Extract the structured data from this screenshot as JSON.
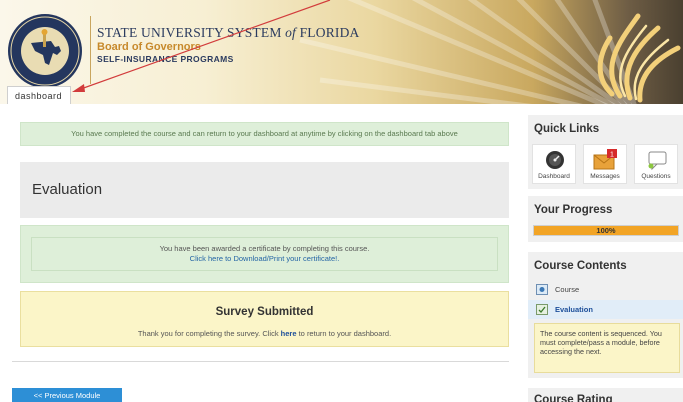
{
  "header": {
    "org_line1_part1": "STATE UNIVERSITY SYSTEM ",
    "org_line1_of": "of",
    "org_line1_part2": " FLORIDA",
    "org_line2": "Board of Governors",
    "org_line3": "SELF-INSURANCE PROGRAMS",
    "dashboard_tab": "dashboard",
    "colors": {
      "navy": "#2b3b5f",
      "gold": "#c7892b"
    }
  },
  "main": {
    "completed_notice": "You have completed the course and can return to your dashboard at anytime by clicking on the dashboard tab above",
    "evaluation_title": "Evaluation",
    "certificate_text": "You have been awarded a certificate by completing this course.",
    "certificate_link": "Click here to Download/Print your certificate!.",
    "survey_title": "Survey Submitted",
    "survey_text_before": "Thank you for completing the survey. Click ",
    "survey_link": "here",
    "survey_text_after": " to return to your dashboard.",
    "prev_module_button": "<< Previous Module"
  },
  "sidebar": {
    "quick_links": {
      "title": "Quick Links",
      "items": [
        {
          "label": "Dashboard",
          "icon": "dashboard-icon"
        },
        {
          "label": "Messages",
          "icon": "envelope-icon",
          "badge": "1"
        },
        {
          "label": "Questions",
          "icon": "question-bubble-icon"
        }
      ]
    },
    "progress": {
      "title": "Your Progress",
      "value": 100,
      "label": "100%"
    },
    "course_contents": {
      "title": "Course Contents",
      "items": [
        {
          "label": "Course",
          "active": false
        },
        {
          "label": "Evaluation",
          "active": true
        }
      ],
      "note": "The course content is sequenced. You must complete/pass a module, before accessing the next."
    },
    "course_rating": {
      "title": "Course Rating"
    }
  }
}
